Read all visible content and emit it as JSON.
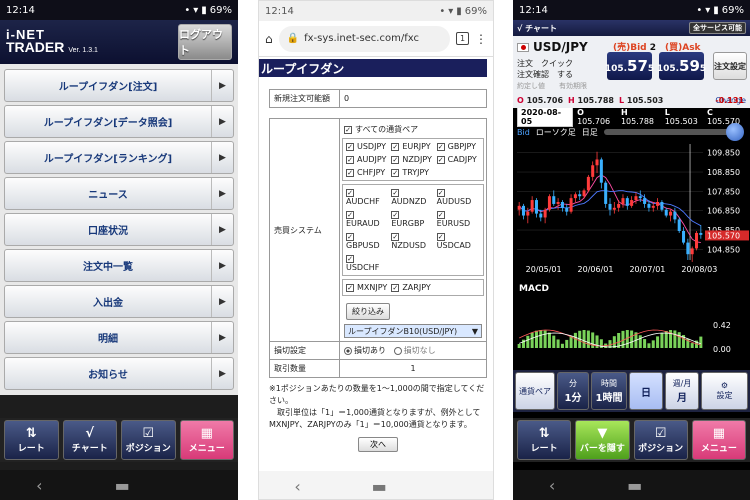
{
  "status": {
    "time": "12:14",
    "battery": "69%"
  },
  "p1": {
    "logo_line1": "i-NET",
    "logo_line2": "TRADER",
    "version": "Ver. 1.3.1",
    "logout": "ログアウト",
    "menu": [
      {
        "label": "ループイフダン[注文]"
      },
      {
        "label": "ループイフダン[データ照会]"
      },
      {
        "label": "ループイフダン[ランキング]"
      },
      {
        "label": "ニュース"
      },
      {
        "label": "口座状況"
      },
      {
        "label": "注文中一覧"
      },
      {
        "label": "入出金"
      },
      {
        "label": "明細"
      },
      {
        "label": "お知らせ"
      }
    ],
    "tabs": [
      {
        "label": "レート",
        "icon": "arrows-updown-icon"
      },
      {
        "label": "チャート",
        "icon": "chart-line-icon"
      },
      {
        "label": "ポジション",
        "icon": "checkbox-icon"
      },
      {
        "label": "メニュー",
        "icon": "grid-icon"
      }
    ]
  },
  "p2": {
    "url": "fx-sys.inet-sec.com/fxc",
    "tab_count": "1",
    "title": "ループイフダン",
    "new_order_label": "新規注文可能額",
    "new_order_value": "0",
    "trade_system_label": "売買システム",
    "all_pairs": "すべての通貨ペア",
    "group1": [
      "USDJPY",
      "EURJPY",
      "GBPJPY",
      "AUDJPY",
      "NZDJPY",
      "CADJPY",
      "CHFJPY",
      "TRYJPY"
    ],
    "group2": [
      "AUDCHF",
      "AUDNZD",
      "AUDUSD",
      "EURAUD",
      "EURGBP",
      "EURUSD",
      "GBPUSD",
      "NZDUSD",
      "USDCAD",
      "USDCHF"
    ],
    "group3": [
      "MXNJPY",
      "ZARJPY"
    ],
    "filter_button": "絞り込み",
    "selected_system": "ループイフダンB10(USD/JPY)",
    "stoploss_label": "損切設定",
    "stoploss_on": "損切あり",
    "stoploss_off": "損切なし",
    "qty_label": "取引数量",
    "qty_value": "1",
    "note1": "※1ポジションあたりの数量を1～1,000の間で指定してください。",
    "note2": "　取引単位は「1」＝1,000通貨となりますが、例外として MXNJPY、ZARJPYのみ「1」＝10,000通貨となります。",
    "next_button": "次へ"
  },
  "p3": {
    "header_title": "チャート",
    "all_service": "全サービス可能",
    "pair": "USD/JPY",
    "sell_label": "(売)Bid",
    "spread_value": "2",
    "buy_label": "(買)Ask",
    "bid_small": "105.",
    "bid_big": "57",
    "bid_tail": "5",
    "ask_small": "105.",
    "ask_big": "59",
    "ask_tail": "5",
    "order_setting": "注文設定",
    "order_label": "注文",
    "order_value": "クイック",
    "confirm_label": "注文確認",
    "confirm_value": "する",
    "limits_text": "約定し値　　有効期限",
    "o": "105.706",
    "h": "105.788",
    "l": "105.503",
    "change_label": "Change",
    "change_value": "-0.131",
    "chart_date": "2020-08-05",
    "chart_o": "105.706",
    "chart_h": "105.788",
    "chart_l": "105.503",
    "chart_c": "105.570",
    "ctl_bid": "Bid",
    "ctl_type": "ローソク足",
    "ctl_period": "日足",
    "macd_label": "MACD",
    "bottom": {
      "pair_btn": "通貨ペア",
      "min_lbl": "分",
      "min_val": "1分",
      "hour_lbl": "時間",
      "hour_val": "1時間",
      "day_val": "日",
      "wm_lbl": "週/月",
      "wm_val": "月",
      "settings": "設定"
    },
    "tabs": [
      {
        "label": "レート"
      },
      {
        "label": "バーを隠す"
      },
      {
        "label": "ポジション"
      },
      {
        "label": "メニュー"
      }
    ]
  },
  "chart_data": {
    "type": "candlestick",
    "xlabel": "",
    "ylabel": "",
    "x_ticks": [
      "20/05/01",
      "20/06/01",
      "20/07/01",
      "20/08/03"
    ],
    "y_ticks": [
      109.85,
      108.85,
      107.85,
      106.85,
      105.85,
      104.85
    ],
    "y_range": [
      104.3,
      110.3
    ],
    "last_price": "105.570",
    "candles": [
      [
        106.9,
        107.3,
        106.6,
        107.1
      ],
      [
        107.1,
        107.2,
        106.4,
        106.6
      ],
      [
        106.6,
        107.0,
        106.2,
        106.8
      ],
      [
        106.8,
        107.6,
        106.7,
        107.4
      ],
      [
        107.4,
        107.5,
        106.5,
        106.7
      ],
      [
        106.7,
        106.9,
        106.3,
        106.5
      ],
      [
        106.5,
        107.0,
        106.2,
        106.9
      ],
      [
        106.9,
        107.7,
        106.8,
        107.6
      ],
      [
        107.6,
        107.9,
        107.1,
        107.2
      ],
      [
        107.2,
        107.5,
        106.9,
        107.3
      ],
      [
        107.3,
        107.4,
        106.8,
        107.0
      ],
      [
        107.0,
        107.2,
        106.6,
        106.8
      ],
      [
        106.8,
        107.7,
        106.7,
        107.5
      ],
      [
        107.5,
        107.8,
        107.3,
        107.7
      ],
      [
        107.7,
        107.9,
        107.4,
        107.6
      ],
      [
        107.6,
        108.0,
        107.5,
        107.9
      ],
      [
        107.9,
        108.7,
        107.8,
        108.6
      ],
      [
        108.6,
        109.4,
        108.4,
        109.2
      ],
      [
        109.2,
        109.9,
        108.8,
        109.5
      ],
      [
        109.5,
        109.6,
        108.0,
        108.3
      ],
      [
        108.3,
        108.4,
        107.0,
        107.2
      ],
      [
        107.2,
        107.5,
        106.6,
        106.9
      ],
      [
        106.9,
        107.3,
        106.7,
        107.0
      ],
      [
        107.0,
        107.4,
        106.8,
        107.2
      ],
      [
        107.2,
        107.7,
        107.0,
        107.5
      ],
      [
        107.5,
        107.6,
        106.9,
        107.1
      ],
      [
        107.1,
        107.6,
        107.0,
        107.4
      ],
      [
        107.4,
        107.8,
        107.2,
        107.6
      ],
      [
        107.6,
        107.9,
        107.3,
        107.5
      ],
      [
        107.5,
        107.7,
        107.0,
        107.2
      ],
      [
        107.2,
        107.4,
        106.8,
        107.0
      ],
      [
        107.0,
        107.3,
        106.8,
        107.1
      ],
      [
        107.1,
        107.5,
        106.9,
        107.3
      ],
      [
        107.3,
        107.4,
        106.8,
        106.9
      ],
      [
        106.9,
        107.0,
        106.5,
        106.6
      ],
      [
        106.6,
        106.9,
        106.3,
        106.8
      ],
      [
        106.8,
        107.0,
        106.2,
        106.4
      ],
      [
        106.4,
        106.5,
        105.7,
        105.8
      ],
      [
        105.8,
        106.0,
        105.1,
        105.2
      ],
      [
        105.2,
        105.4,
        104.3,
        104.6
      ],
      [
        104.6,
        105.0,
        104.2,
        104.9
      ],
      [
        104.9,
        105.8,
        104.8,
        105.7
      ],
      [
        105.7,
        106.1,
        105.4,
        105.6
      ]
    ]
  }
}
